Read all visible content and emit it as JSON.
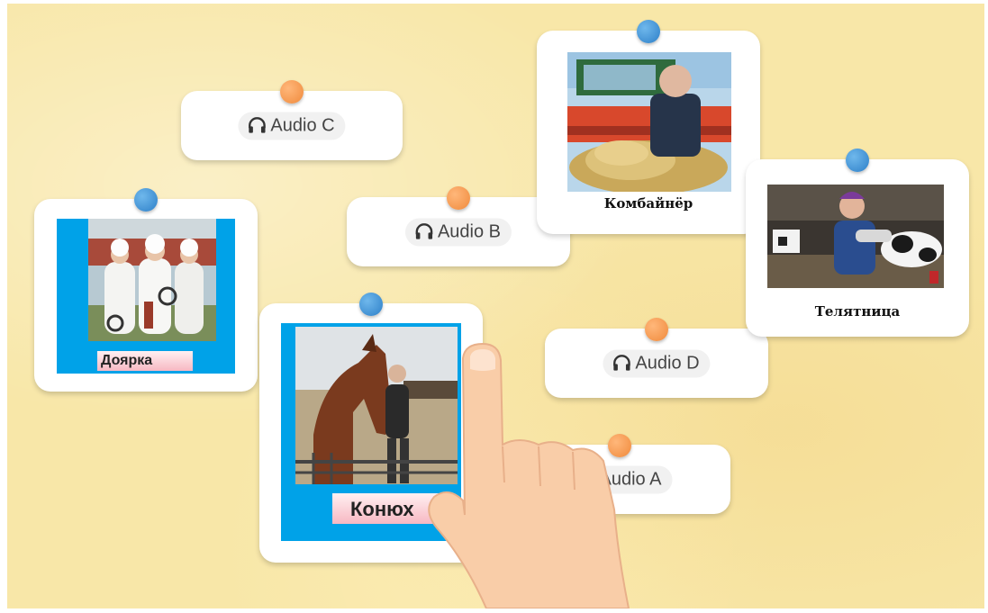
{
  "audio_cards": {
    "c": {
      "label": "Audio C",
      "icon": "headphones-icon"
    },
    "b": {
      "label": "Audio B",
      "icon": "headphones-icon"
    },
    "d": {
      "label": "Audio D",
      "icon": "headphones-icon"
    },
    "a": {
      "label": "Audio A",
      "icon": "headphones-icon"
    }
  },
  "image_cards": {
    "kombainer": {
      "caption": "Комбайнёр"
    },
    "telyatnitsa": {
      "caption": "Телятница"
    },
    "doyarka": {
      "caption": "Доярка"
    },
    "konyukh": {
      "caption": "Конюх"
    }
  },
  "colors": {
    "board": "#f8e7a8",
    "pin_blue": "#2d7fc8",
    "pin_orange": "#f08a3c",
    "photo_frame_blue": "#00a2e8",
    "label_pink": "#f7b8c2",
    "hand": "#f9cda8"
  }
}
